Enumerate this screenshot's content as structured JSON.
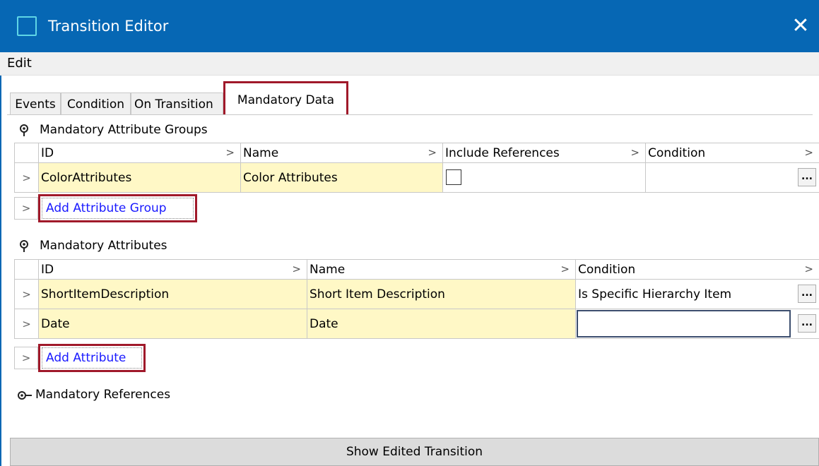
{
  "window": {
    "title": "Transition Editor",
    "close_symbol": "✕"
  },
  "menu": {
    "items": [
      "Edit"
    ]
  },
  "tabs": [
    {
      "label": "Events",
      "active": false
    },
    {
      "label": "Condition",
      "active": false
    },
    {
      "label": "On Transition",
      "active": false
    },
    {
      "label": "Mandatory Data",
      "active": true
    }
  ],
  "attribute_groups": {
    "title": "Mandatory Attribute Groups",
    "columns": [
      "ID",
      "Name",
      "Include References",
      "Condition"
    ],
    "rows": [
      {
        "id": "ColorAttributes",
        "name": "Color Attributes",
        "include_references": false,
        "condition": ""
      }
    ],
    "add_label": "Add Attribute Group"
  },
  "attributes": {
    "title": "Mandatory Attributes",
    "columns": [
      "ID",
      "Name",
      "Condition"
    ],
    "rows": [
      {
        "id": "ShortItemDescription",
        "name": "Short Item Description",
        "condition": "Is Specific Hierarchy Item"
      },
      {
        "id": "Date",
        "name": "Date",
        "condition": ""
      }
    ],
    "add_label": "Add Attribute"
  },
  "references": {
    "title": "Mandatory References",
    "expanded": false
  },
  "footer": {
    "button_label": "Show Edited Transition"
  },
  "symbols": {
    "row_selector": ">",
    "column_sort": ">",
    "ellipsis": "..."
  },
  "colors": {
    "titlebar": "#0667b4",
    "highlight_border": "#a0192a",
    "cell_highlight": "#fff8c6",
    "link": "#1a1aff"
  }
}
